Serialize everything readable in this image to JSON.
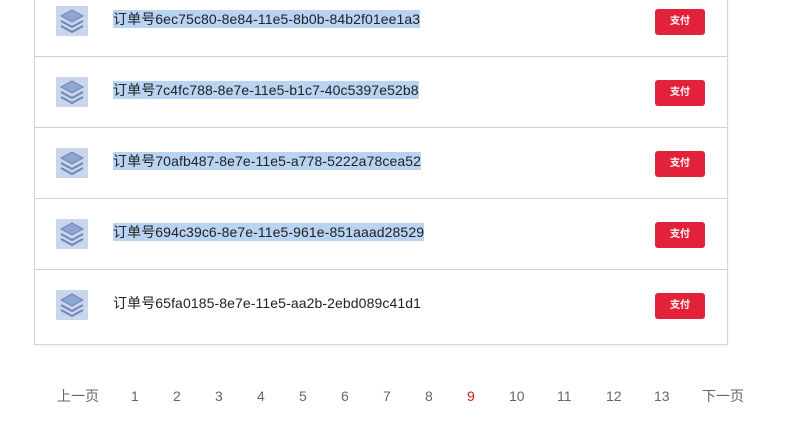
{
  "orders": [
    {
      "label": "订单号6ec75c80-8e84-11e5-8b0b-84b2f01ee1a3",
      "selected": true,
      "pay_label": "支付",
      "icon": "stack-icon"
    },
    {
      "label": "订单号7c4fc788-8e7e-11e5-b1c7-40c5397e52b8",
      "selected": true,
      "pay_label": "支付",
      "icon": "stack-icon"
    },
    {
      "label": "订单号70afb487-8e7e-11e5-a778-5222a78cea52",
      "selected": true,
      "pay_label": "支付",
      "icon": "stack-icon"
    },
    {
      "label": "订单号694c39c6-8e7e-11e5-961e-851aaad28529",
      "selected": true,
      "pay_label": "支付",
      "icon": "stack-icon"
    },
    {
      "label": "订单号65fa0185-8e7e-11e5-aa2b-2ebd089c41d1",
      "selected": false,
      "pay_label": "支付",
      "icon": "stack-icon"
    }
  ],
  "pagination": {
    "prev": "上一页",
    "next": "下一页",
    "pages": [
      "1",
      "2",
      "3",
      "4",
      "5",
      "6",
      "7",
      "8",
      "9",
      "10",
      "11",
      "12",
      "13"
    ],
    "current": "9"
  },
  "colors": {
    "pay_button": "#e2223a",
    "active_page": "#d0161d",
    "selection": "#b9d3f3",
    "icon": "#8fa6d2"
  }
}
